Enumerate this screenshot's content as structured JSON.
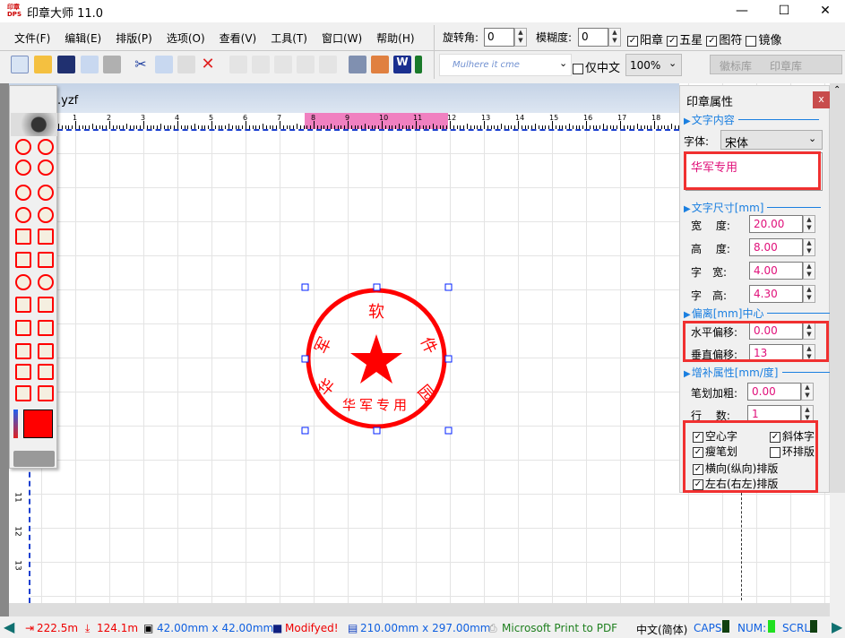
{
  "window": {
    "title": "印章大师 11.0",
    "logo_text": "印章 DPS",
    "controls": [
      "minimize",
      "maximize",
      "close"
    ]
  },
  "menu": [
    "文件(F)",
    "编辑(E)",
    "排版(P)",
    "选项(O)",
    "查看(V)",
    "工具(T)",
    "窗口(W)",
    "帮助(H)"
  ],
  "options": {
    "rotate_label": "旋转角:",
    "rotate_value": "0",
    "blur_label": "模糊度:",
    "blur_value": "0",
    "checks": [
      {
        "label": "阳章",
        "checked": true
      },
      {
        "label": "五星",
        "checked": true
      },
      {
        "label": "图符",
        "checked": true
      },
      {
        "label": "镜像",
        "checked": false
      }
    ]
  },
  "toolbar2": {
    "font_preview": "Mulhere it cme",
    "chinese_only_label": "仅中文",
    "chinese_only": false,
    "zoom": "100%",
    "tabs": [
      "徽标库",
      "印章库"
    ]
  },
  "document": {
    "tab": ".yzf",
    "ruler_labels": [
      "1",
      "2",
      "3",
      "4",
      "5",
      "6",
      "7",
      "8",
      "9",
      "10",
      "11",
      "12",
      "13",
      "14",
      "15",
      "16",
      "17",
      "18",
      "19"
    ],
    "vruler_labels": [
      "11",
      "12",
      "13"
    ]
  },
  "stamp": {
    "arc_text": [
      "华",
      "军",
      "软",
      "件",
      "园"
    ],
    "bottom_text": "华军专用",
    "color": "#ff0000"
  },
  "panel": {
    "title": "印章属性",
    "close": "x",
    "sec_content": "文字内容",
    "font_label": "字体:",
    "font_value": "宋体",
    "text_value": "华军专用",
    "sec_size": "文字尺寸[mm]",
    "size_fields": [
      {
        "label": "宽　 度:",
        "value": "20.00"
      },
      {
        "label": "高　 度:",
        "value": "8.00"
      },
      {
        "label": "字　宽:",
        "value": "4.00"
      },
      {
        "label": "字　高:",
        "value": "4.30"
      }
    ],
    "sec_offset": "偏离[mm]中心",
    "offset_fields": [
      {
        "label": "水平偏移:",
        "value": "0.00"
      },
      {
        "label": "垂直偏移:",
        "value": "13"
      }
    ],
    "sec_extra": "增补属性[mm/度]",
    "extra_fields": [
      {
        "label": "笔划加粗:",
        "value": "0.00"
      },
      {
        "label": "行　 数:",
        "value": "1"
      }
    ],
    "checks": [
      {
        "label": "空心字",
        "checked": true
      },
      {
        "label": "斜体字",
        "checked": true
      },
      {
        "label": "瘦笔划",
        "checked": true
      },
      {
        "label": "环排版",
        "checked": false
      },
      {
        "label": "横向(纵向)排版",
        "checked": true
      },
      {
        "label": "左右(右左)排版",
        "checked": true
      }
    ]
  },
  "status": {
    "x": "222.5m",
    "y": "124.1m",
    "size": "42.00mm x 42.00mm",
    "modified": "Modifyed!",
    "page": "210.00mm x 297.00mm",
    "printer": "Microsoft Print to PDF",
    "ime": "中文(简体)",
    "caps": "CAPS:",
    "num": "NUM:",
    "scrl": "SCRL:"
  }
}
